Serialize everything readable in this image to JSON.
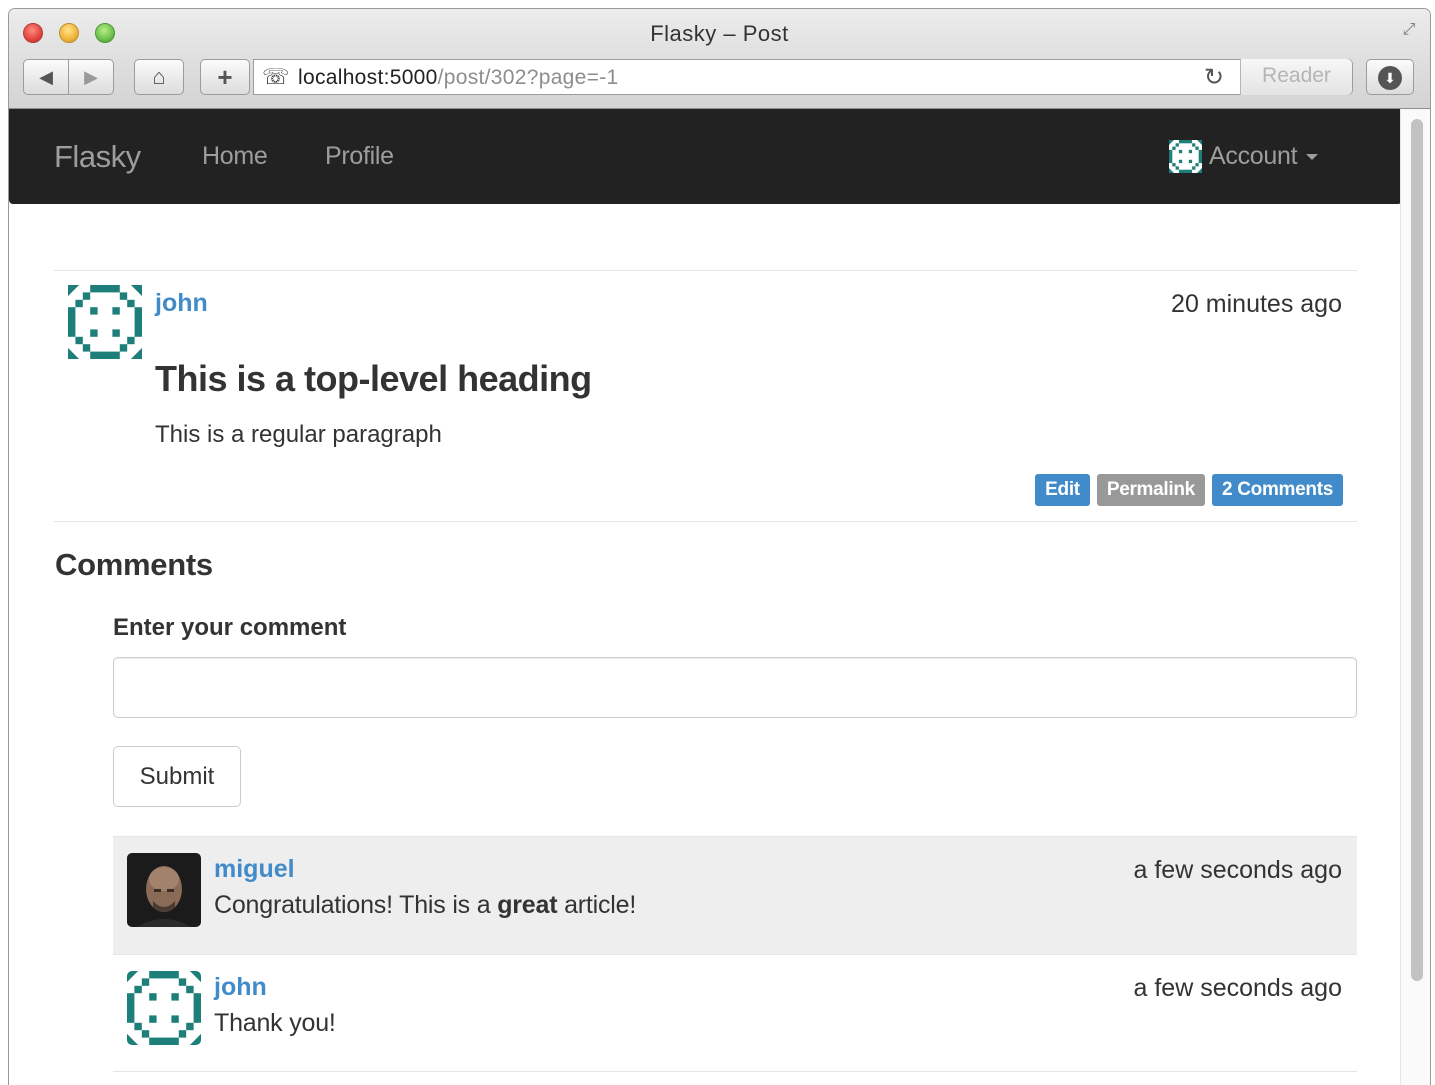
{
  "browser": {
    "window_title": "Flasky – Post",
    "url_host": "localhost:5000",
    "url_path": "/post/302?page=-1",
    "reader_label": "Reader"
  },
  "navbar": {
    "brand": "Flasky",
    "links": [
      "Home",
      "Profile"
    ],
    "account_label": "Account"
  },
  "post": {
    "author": "john",
    "timestamp": "20 minutes ago",
    "heading": "This is a top-level heading",
    "paragraph": "This is a regular paragraph",
    "actions": {
      "edit": "Edit",
      "permalink": "Permalink",
      "comments": "2 Comments"
    }
  },
  "comments_section": {
    "title": "Comments",
    "form_label": "Enter your comment",
    "input_value": "",
    "submit_label": "Submit",
    "items": [
      {
        "author": "miguel",
        "timestamp": "a few seconds ago",
        "body_before": "Congratulations! This is a ",
        "body_bold": "great",
        "body_after": " article!"
      },
      {
        "author": "john",
        "timestamp": "a few seconds ago",
        "body": "Thank you!"
      }
    ]
  },
  "colors": {
    "navbar_bg": "#222222",
    "link": "#428bca",
    "label_primary": "#428bca",
    "label_default": "#999999",
    "identicon": "#1e7f7a"
  }
}
